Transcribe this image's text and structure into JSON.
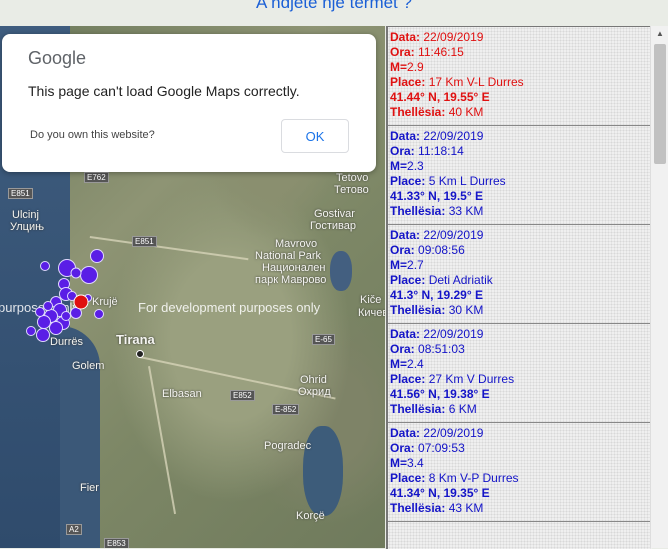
{
  "page": {
    "title": "A ndjetë një tërmet ?"
  },
  "dialog": {
    "logo": "Google",
    "message": "This page can't load Google Maps correctly.",
    "question": "Do you own this website?",
    "ok_label": "OK"
  },
  "map": {
    "dev_text_left": "purposes only",
    "dev_text_right": "For development purposes only",
    "labels": {
      "tetovo": "Tetovo",
      "tetovo_cyr": "Тетово",
      "gostivar": "Gostivar",
      "gostivar_cyr": "Гостивар",
      "mavrovo1": "Mavrovo",
      "mavrovo2": "National Park",
      "mavrovo3": "Национален",
      "mavrovo4": "парк Маврово",
      "ulcinj": "Ulcinj",
      "ulcinj_cyr": "Улцињ",
      "kicevo": "Kiče",
      "kicevo_cyr": "Кичево",
      "kruje": "Krujë",
      "tirana": "Tirana",
      "durres": "Durrës",
      "golem": "Golem",
      "elbasan": "Elbasan",
      "ohrid": "Ohrid",
      "ohrid_cyr": "Охрид",
      "pogradec": "Pogradec",
      "fier": "Fier",
      "korce": "Korçë"
    },
    "shields": {
      "e851a": "E851",
      "e851b": "E851",
      "e762": "E762",
      "e65": "E-65",
      "e852a": "E852",
      "e852b": "E-852",
      "a2": "A2",
      "e853": "E853"
    },
    "colors": {
      "quake": "#5a1ee6",
      "latest": "#e01010"
    }
  },
  "entries": [
    {
      "data": "22/09/2019",
      "ora": "11:46:15",
      "m": "2.9",
      "place": "17 Km V-L Durres",
      "coords": "41.44° N, 19.55° E",
      "depth": "40 KM",
      "color": "#e01010"
    },
    {
      "data": "22/09/2019",
      "ora": "11:18:14",
      "m": "2.3",
      "place": "5 Km L Durres",
      "coords": "41.33° N, 19.5° E",
      "depth": "33 KM",
      "color": "#1414c8"
    },
    {
      "data": "22/09/2019",
      "ora": "09:08:56",
      "m": "2.7",
      "place": "Deti Adriatik",
      "coords": "41.3° N, 19.29° E",
      "depth": "30 KM",
      "color": "#1414c8"
    },
    {
      "data": "22/09/2019",
      "ora": "08:51:03",
      "m": "2.4",
      "place": "27 Km V Durres",
      "coords": "41.56° N, 19.38° E",
      "depth": "6 KM",
      "color": "#1414c8"
    },
    {
      "data": "22/09/2019",
      "ora": "07:09:53",
      "m": "3.4",
      "place": "8 Km V-P Durres",
      "coords": "41.34° N, 19.35° E",
      "depth": "43 KM",
      "color": "#1414c8"
    }
  ],
  "field_labels": {
    "data": "Data:",
    "ora": "Ora:",
    "m": "M=",
    "place": "Place:",
    "depth": "Thellësia:"
  }
}
